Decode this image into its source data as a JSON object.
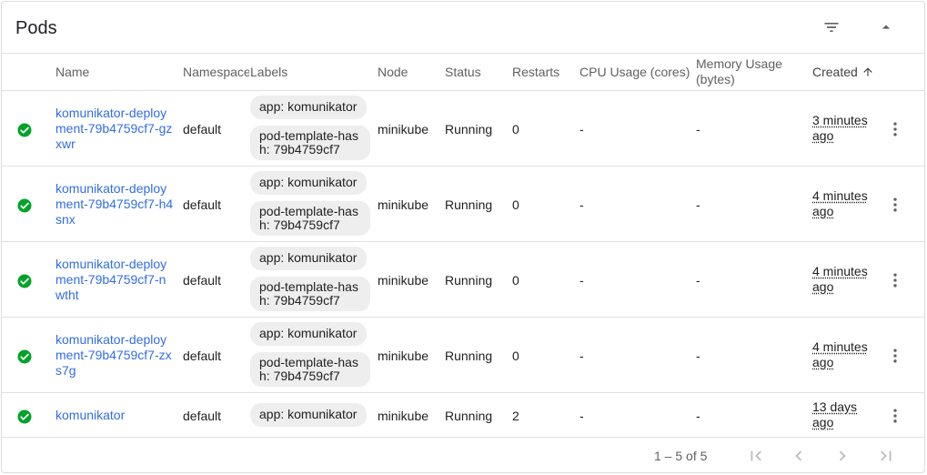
{
  "header": {
    "title": "Pods",
    "filter_icon": "filter-icon",
    "collapse_icon": "chevron-up-icon"
  },
  "columns": {
    "name": "Name",
    "namespace": "Namespace",
    "labels": "Labels",
    "node": "Node",
    "status": "Status",
    "restarts": "Restarts",
    "cpu": "CPU Usage (cores)",
    "memory": "Memory Usage (bytes)",
    "created": "Created",
    "sort_icon": "arrow-up-icon"
  },
  "rows": [
    {
      "name": "komunikator-deployment-79b4759cf7-gzxwr",
      "namespace": "default",
      "label_app": "app: komunikator",
      "label_hash": "pod-template-hash: 79b4759cf7",
      "node": "minikube",
      "status": "Running",
      "restarts": "0",
      "cpu": "-",
      "memory": "-",
      "created": "3 minutes ago"
    },
    {
      "name": "komunikator-deployment-79b4759cf7-h4snx",
      "namespace": "default",
      "label_app": "app: komunikator",
      "label_hash": "pod-template-hash: 79b4759cf7",
      "node": "minikube",
      "status": "Running",
      "restarts": "0",
      "cpu": "-",
      "memory": "-",
      "created": "4 minutes ago"
    },
    {
      "name": "komunikator-deployment-79b4759cf7-nwtht",
      "namespace": "default",
      "label_app": "app: komunikator",
      "label_hash": "pod-template-hash: 79b4759cf7",
      "node": "minikube",
      "status": "Running",
      "restarts": "0",
      "cpu": "-",
      "memory": "-",
      "created": "4 minutes ago"
    },
    {
      "name": "komunikator-deployment-79b4759cf7-zxs7g",
      "namespace": "default",
      "label_app": "app: komunikator",
      "label_hash": "pod-template-hash: 79b4759cf7",
      "node": "minikube",
      "status": "Running",
      "restarts": "0",
      "cpu": "-",
      "memory": "-",
      "created": "4 minutes ago"
    },
    {
      "name": "komunikator",
      "namespace": "default",
      "label_app": "app: komunikator",
      "node": "minikube",
      "status": "Running",
      "restarts": "2",
      "cpu": "-",
      "memory": "-",
      "created": "13 days ago"
    }
  ],
  "status_icon": "check-circle-icon",
  "status_color": "#00a32a",
  "link_color": "#326de6",
  "pagination": {
    "range": "1 – 5 of 5"
  }
}
